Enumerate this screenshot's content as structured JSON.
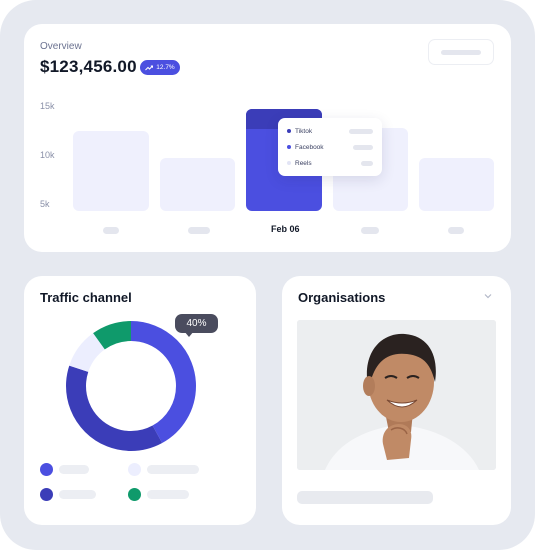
{
  "overview": {
    "label": "Overview",
    "amount": "$123,456.00",
    "change_badge": {
      "icon": "trend-up-icon",
      "text": "12.7%"
    }
  },
  "chart_data": {
    "type": "bar",
    "yticks": [
      "15k",
      "10k",
      "5k"
    ],
    "categories": [
      "",
      "",
      "Feb 06",
      "",
      ""
    ],
    "active_index": 2,
    "tooltip": {
      "series": [
        {
          "name": "Tiktok",
          "color": "#3b3db8"
        },
        {
          "name": "Facebook",
          "color": "#4b4fe0"
        },
        {
          "name": "Reels",
          "color": "#e2e4f5"
        }
      ]
    }
  },
  "traffic": {
    "title": "Traffic channel",
    "highlight_percent": "40%",
    "segments": [
      {
        "color": "#4b4fe0",
        "fraction": 0.42
      },
      {
        "color": "#3b3db8",
        "fraction": 0.38
      },
      {
        "color": "#eceefe",
        "fraction": 0.1
      },
      {
        "color": "#0f9a6b",
        "fraction": 0.1
      }
    ],
    "legend_colors": [
      "#4b4fe0",
      "#eceefe",
      "#3b3db8",
      "#0f9a6b"
    ]
  },
  "organisations": {
    "title": "Organisations",
    "dropdown_icon": "chevron-down-icon",
    "photo": "person-photo"
  }
}
